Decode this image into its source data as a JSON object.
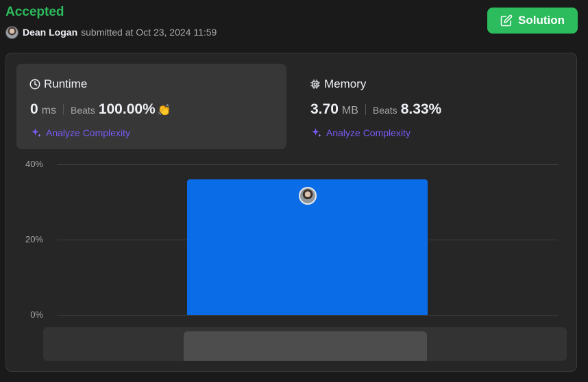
{
  "status": "Accepted",
  "submission": {
    "user": "Dean Logan",
    "submitted_text": "submitted at Oct 23, 2024 11:59"
  },
  "solution_button": {
    "label": "Solution",
    "icon": "edit-icon"
  },
  "runtime": {
    "title": "Runtime",
    "icon": "clock-icon",
    "value": "0",
    "unit": "ms",
    "beats_label": "Beats",
    "beats_value": "100.00%",
    "badge_icon": "clapping-hands-icon",
    "analyze_label": "Analyze Complexity"
  },
  "memory": {
    "title": "Memory",
    "icon": "chip-icon",
    "value": "3.70",
    "unit": "MB",
    "beats_label": "Beats",
    "beats_value": "8.33%",
    "analyze_label": "Analyze Complexity"
  },
  "colors": {
    "accepted": "#2cbb5d",
    "bar": "#0a6ce6",
    "analyze": "#7a5af5"
  },
  "chart_data": {
    "type": "bar",
    "ylim": [
      0,
      40
    ],
    "y_ticks": [
      "40%",
      "20%",
      "0%"
    ],
    "bars": [
      {
        "value": 36,
        "highlight_user": true
      }
    ],
    "grid": true
  }
}
